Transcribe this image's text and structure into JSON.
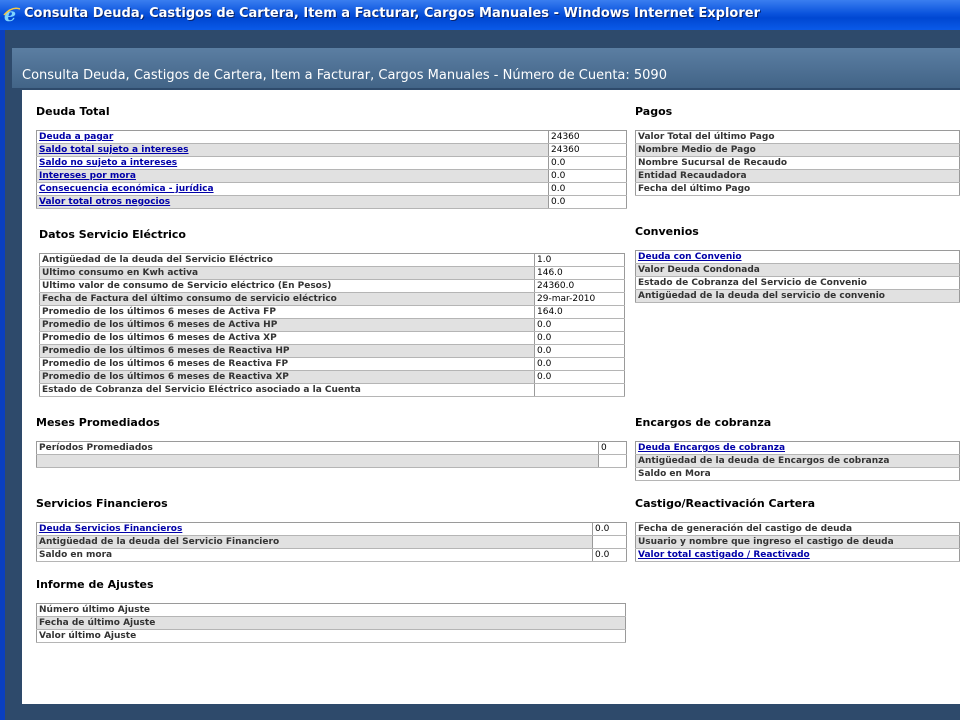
{
  "window": {
    "title": "Consulta Deuda, Castigos de Cartera, Item a Facturar, Cargos Manuales - Windows Internet Explorer"
  },
  "page": {
    "title": "Consulta Deuda, Castigos de Cartera, Item a Facturar, Cargos Manuales - Número de Cuenta: 5090"
  },
  "deuda_total": {
    "title": "Deuda Total",
    "rows": [
      {
        "label": "Deuda a pagar",
        "value": "24360"
      },
      {
        "label": "Saldo total sujeto a intereses",
        "value": "24360"
      },
      {
        "label": "Saldo no sujeto a intereses",
        "value": "0.0"
      },
      {
        "label": "Intereses por mora",
        "value": "0.0"
      },
      {
        "label": "Consecuencia económica - jurídica",
        "value": "0.0"
      },
      {
        "label": "Valor total otros negocios",
        "value": "0.0"
      }
    ]
  },
  "pagos": {
    "title": "Pagos",
    "rows": [
      {
        "label": "Valor Total del último Pago"
      },
      {
        "label": "Nombre Medio de Pago"
      },
      {
        "label": "Nombre Sucursal de Recaudo"
      },
      {
        "label": "Entidad Recaudadora"
      },
      {
        "label": "Fecha del último Pago"
      }
    ]
  },
  "servicio_electrico": {
    "title": "Datos Servicio Eléctrico",
    "rows": [
      {
        "label": "Antigüedad de la deuda del Servicio Eléctrico",
        "value": "1.0"
      },
      {
        "label": "Ultimo consumo en Kwh activa",
        "value": "146.0"
      },
      {
        "label": "Ultimo valor de consumo de Servicio eléctrico (En Pesos)",
        "value": "24360.0"
      },
      {
        "label": "Fecha de Factura del último consumo de servicio eléctrico",
        "value": "29-mar-2010"
      },
      {
        "label": "Promedio de los últimos 6 meses de Activa FP",
        "value": "164.0"
      },
      {
        "label": "Promedio de los últimos 6 meses de Activa HP",
        "value": "0.0"
      },
      {
        "label": "Promedio de los últimos 6 meses de Activa XP",
        "value": "0.0"
      },
      {
        "label": "Promedio de los últimos 6 meses de Reactiva HP",
        "value": "0.0"
      },
      {
        "label": "Promedio de los últimos 6 meses de Reactiva FP",
        "value": "0.0"
      },
      {
        "label": "Promedio de los últimos 6 meses de Reactiva XP",
        "value": "0.0"
      },
      {
        "label": "Estado de Cobranza del Servicio Eléctrico asociado a la Cuenta",
        "value": ""
      }
    ]
  },
  "convenios": {
    "title": "Convenios",
    "rows": [
      {
        "label": "Deuda con Convenio"
      },
      {
        "label": "Valor Deuda Condonada"
      },
      {
        "label": "Estado de Cobranza del Servicio de Convenio"
      },
      {
        "label": "Antigüedad de la deuda del servicio de convenio"
      }
    ]
  },
  "meses_promediados": {
    "title": "Meses Promediados",
    "rows": [
      {
        "label": "Períodos Promediados",
        "value": "0"
      }
    ]
  },
  "encargos": {
    "title": "Encargos de cobranza",
    "rows": [
      {
        "label": "Deuda Encargos de cobranza"
      },
      {
        "label": "Antigüedad de la deuda de Encargos de cobranza"
      },
      {
        "label": "Saldo en Mora"
      }
    ]
  },
  "servicios_financieros": {
    "title": "Servicios Financieros",
    "rows": [
      {
        "label": "Deuda Servicios Financieros",
        "value": "0.0"
      },
      {
        "label": "Antigüedad de la deuda del Servicio Financiero",
        "value": ""
      },
      {
        "label": "Saldo en mora",
        "value": "0.0"
      }
    ]
  },
  "castigo": {
    "title": "Castigo/Reactivación Cartera",
    "rows": [
      {
        "label": "Fecha de generación del castigo de deuda"
      },
      {
        "label": "Usuario y nombre que ingreso el castigo de deuda"
      },
      {
        "label": "Valor total castigado / Reactivado"
      }
    ]
  },
  "informe_ajustes": {
    "title": "Informe de Ajustes",
    "rows": [
      {
        "label": "Número último Ajuste"
      },
      {
        "label": "Fecha de último Ajuste"
      },
      {
        "label": "Valor último Ajuste"
      }
    ]
  }
}
